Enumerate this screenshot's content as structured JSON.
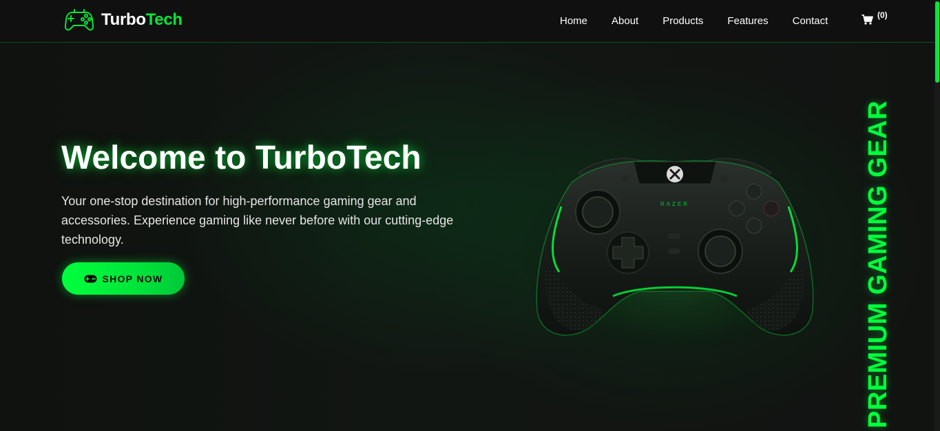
{
  "brand": {
    "name_part1": "Turbo",
    "name_part2": "Tech",
    "icon": "gamepad-icon"
  },
  "nav": {
    "links": [
      "Home",
      "About",
      "Products",
      "Features",
      "Contact"
    ],
    "cart_icon": "cart-icon",
    "cart_count": "(0)"
  },
  "hero": {
    "title": "Welcome to TurboTech",
    "description": "Your one-stop destination for high-performance gaming gear and accessories. Experience gaming like never before with our cutting-edge technology.",
    "cta_label": "SHOP NOW",
    "cta_icon": "gamepad-icon",
    "image": "game-controller-image",
    "side_tag": "PREMIUM GAMING GEAR"
  },
  "colors": {
    "accent": "#00ff3c",
    "background": "#121212",
    "text": "#ffffff"
  }
}
